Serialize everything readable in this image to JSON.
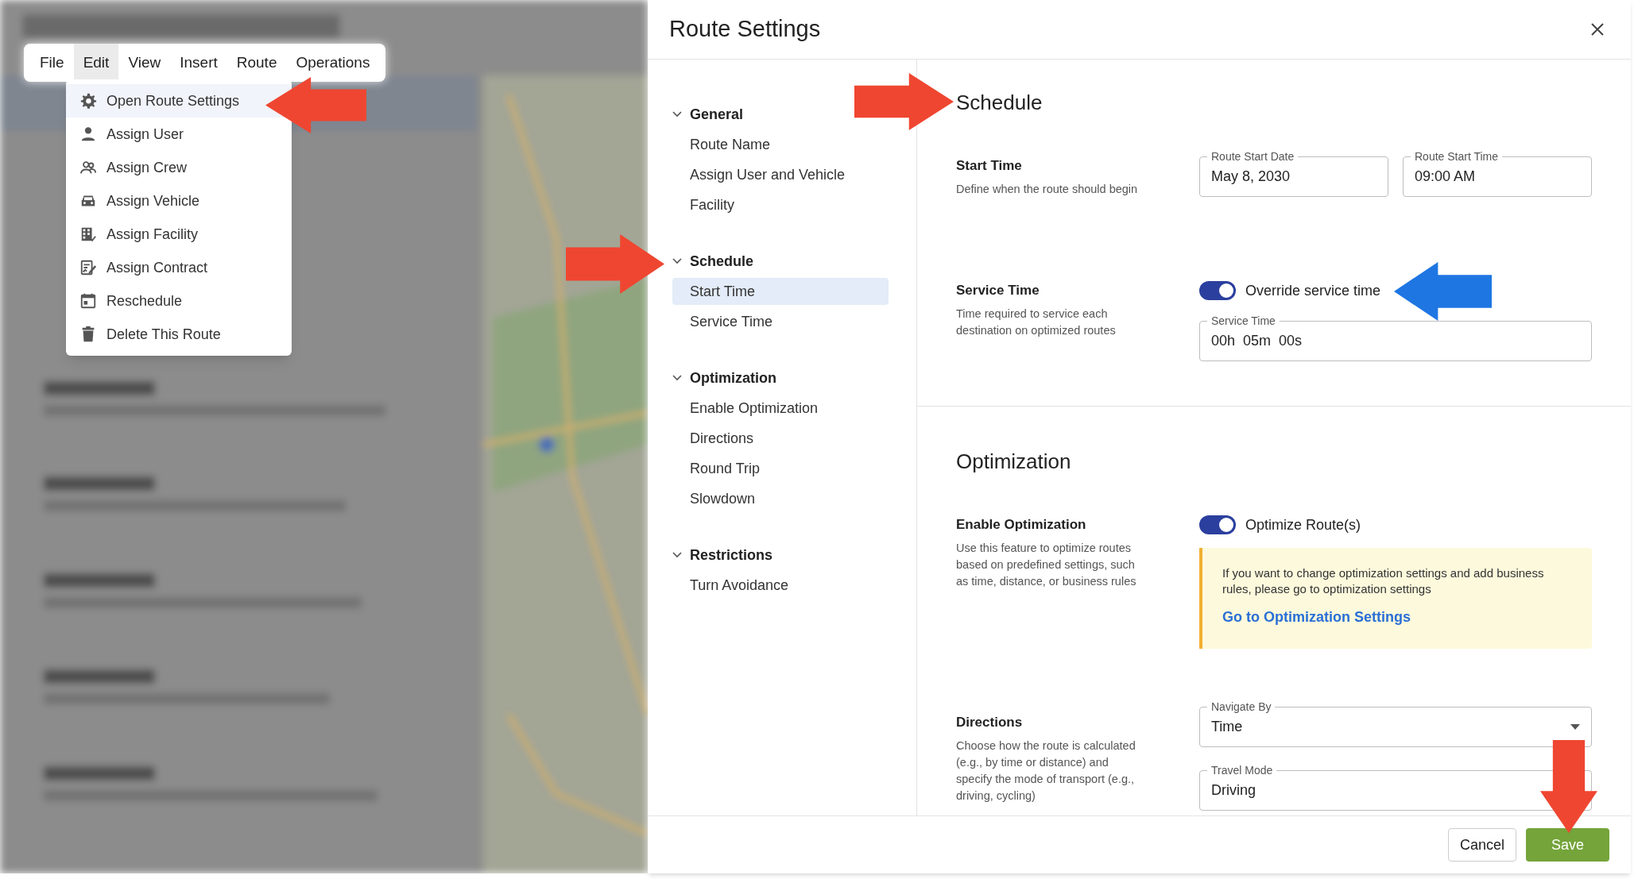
{
  "menu_bar": [
    {
      "label": "File",
      "selected": false
    },
    {
      "label": "Edit",
      "selected": true
    },
    {
      "label": "View",
      "selected": false
    },
    {
      "label": "Insert",
      "selected": false
    },
    {
      "label": "Route",
      "selected": false
    },
    {
      "label": "Operations",
      "selected": false
    }
  ],
  "edit_menu": [
    {
      "label": "Open Route Settings",
      "selected": true
    },
    {
      "label": "Assign User",
      "selected": false
    },
    {
      "label": "Assign Crew",
      "selected": false
    },
    {
      "label": "Assign Vehicle",
      "selected": false
    },
    {
      "label": "Assign Facility",
      "selected": false
    },
    {
      "label": "Assign Contract",
      "selected": false
    },
    {
      "label": "Reschedule",
      "selected": false
    },
    {
      "label": "Delete This Route",
      "selected": false
    }
  ],
  "dialog": {
    "title": "Route Settings",
    "nav": [
      {
        "label": "General",
        "expanded": true,
        "children": [
          {
            "label": "Route Name",
            "selected": false
          },
          {
            "label": "Assign User and Vehicle",
            "selected": false
          },
          {
            "label": "Facility",
            "selected": false
          }
        ]
      },
      {
        "label": "Schedule",
        "expanded": true,
        "children": [
          {
            "label": "Start Time",
            "selected": true
          },
          {
            "label": "Service Time",
            "selected": false
          }
        ]
      },
      {
        "label": "Optimization",
        "expanded": true,
        "children": [
          {
            "label": "Enable Optimization",
            "selected": false
          },
          {
            "label": "Directions",
            "selected": false
          },
          {
            "label": "Round Trip",
            "selected": false
          },
          {
            "label": "Slowdown",
            "selected": false
          }
        ]
      },
      {
        "label": "Restrictions",
        "expanded": true,
        "children": [
          {
            "label": "Turn Avoidance",
            "selected": false
          }
        ]
      }
    ],
    "sections": [
      {
        "title": "Schedule",
        "settings": [
          {
            "label": "Start Time",
            "description": "Define when the route should begin",
            "controls": [
              {
                "kind": "field_pair",
                "fields": [
                  {
                    "label": "Route Start Date",
                    "value": "May 8, 2030"
                  },
                  {
                    "label": "Route Start Time",
                    "value": "09:00 AM"
                  }
                ]
              }
            ]
          },
          {
            "label": "Service Time",
            "description": "Time required to service each destination on optimized routes",
            "controls": [
              {
                "kind": "toggle",
                "label": "Override service time",
                "on": true
              },
              {
                "kind": "field",
                "label": "Service Time",
                "value": "00h  05m  00s"
              }
            ]
          }
        ]
      },
      {
        "title": "Optimization",
        "settings": [
          {
            "label": "Enable Optimization",
            "description": "Use this feature to optimize routes based on predefined settings, such as time, distance, or business rules",
            "controls": [
              {
                "kind": "toggle",
                "label": "Optimize Route(s)",
                "on": true
              },
              {
                "kind": "notice",
                "text": "If you want to change optimization settings and add business rules, please go to optimization settings",
                "link": "Go to Optimization Settings"
              }
            ]
          },
          {
            "label": "Directions",
            "description": "Choose how the route is calculated (e.g., by time or distance) and specify the mode of transport (e.g., driving, cycling)",
            "controls": [
              {
                "kind": "dropdown",
                "label": "Navigate By",
                "value": "Time"
              },
              {
                "kind": "field",
                "label": "Travel Mode",
                "value": "Driving"
              }
            ]
          }
        ]
      }
    ],
    "buttons": [
      {
        "label": "Cancel",
        "kind": "secondary"
      },
      {
        "label": "Save",
        "kind": "primary"
      }
    ]
  }
}
